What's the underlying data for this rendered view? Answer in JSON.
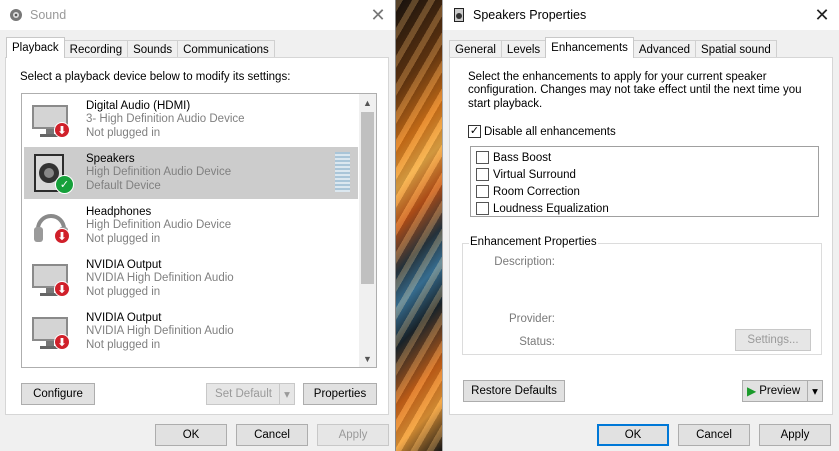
{
  "sound": {
    "title": "Sound",
    "tabs": [
      "Playback",
      "Recording",
      "Sounds",
      "Communications"
    ],
    "instruction": "Select a playback device below to modify its settings:",
    "devices": [
      {
        "name": "Digital Audio (HDMI)",
        "sub": "3- High Definition Audio Device",
        "status": "Not plugged in",
        "icon": "monitor-icon",
        "badge": "unplugged"
      },
      {
        "name": "Speakers",
        "sub": "High Definition Audio Device",
        "status": "Default Device",
        "icon": "speaker-icon",
        "badge": "default"
      },
      {
        "name": "Headphones",
        "sub": "High Definition Audio Device",
        "status": "Not plugged in",
        "icon": "headphones-icon",
        "badge": "unplugged"
      },
      {
        "name": "NVIDIA Output",
        "sub": "NVIDIA High Definition Audio",
        "status": "Not plugged in",
        "icon": "monitor-icon",
        "badge": "unplugged"
      },
      {
        "name": "NVIDIA Output",
        "sub": "NVIDIA High Definition Audio",
        "status": "Not plugged in",
        "icon": "monitor-icon",
        "badge": "unplugged"
      }
    ],
    "buttons": {
      "configure": "Configure",
      "set_default": "Set Default",
      "properties": "Properties",
      "ok": "OK",
      "cancel": "Cancel",
      "apply": "Apply"
    }
  },
  "props": {
    "title": "Speakers Properties",
    "tabs": [
      "General",
      "Levels",
      "Enhancements",
      "Advanced",
      "Spatial sound"
    ],
    "description": "Select the enhancements to apply for your current speaker configuration. Changes may not take effect until the next time you start playback.",
    "disable_all": {
      "label": "Disable all enhancements",
      "checked": true
    },
    "enhancements": [
      {
        "label": "Bass Boost",
        "checked": false
      },
      {
        "label": "Virtual Surround",
        "checked": false
      },
      {
        "label": "Room Correction",
        "checked": false
      },
      {
        "label": "Loudness Equalization",
        "checked": false
      }
    ],
    "group_title": "Enhancement Properties",
    "description_label": "Description:",
    "provider_label": "Provider:",
    "status_label": "Status:",
    "buttons": {
      "settings": "Settings...",
      "restore": "Restore Defaults",
      "preview": "Preview",
      "ok": "OK",
      "cancel": "Cancel",
      "apply": "Apply"
    }
  },
  "colors": {
    "selected_row": "#cccccc",
    "unplugged_badge": "#d0202a",
    "default_badge": "#16a03a",
    "focus_blue": "#0078d7"
  }
}
